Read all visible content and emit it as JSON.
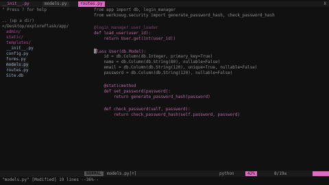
{
  "tabs": [
    "__init__.py",
    "models.py",
    "routes.py"
  ],
  "tab_close": "X",
  "sidebar": {
    "help": "\" Press ? for help",
    "up_dir": ".. (up a dir)",
    "path": "</Desktop/exploreFlask/app/",
    "items": [
      {
        "label": "admin/",
        "type": "dir"
      },
      {
        "label": "static/",
        "type": "dir"
      },
      {
        "label": "templates/",
        "type": "dir"
      },
      {
        "label": "__init__.py",
        "type": "file"
      },
      {
        "label": "config.py",
        "type": "file"
      },
      {
        "label": "forms.py",
        "type": "file"
      },
      {
        "label": "models.py",
        "type": "file"
      },
      {
        "label": "routes.py",
        "type": "file"
      },
      {
        "label": "Site.db",
        "type": "file"
      }
    ]
  },
  "code": {
    "l1": "from app import db, login_manager",
    "l2": "from werkzeug.security import generate_password_hash, check_password_hash",
    "l3": "@login_manager.user_loader",
    "l4": "def load_user(user_id):",
    "l5": "    return User.get(int(user_id))",
    "l6": "lass User(db.Model):",
    "l7": "    id = db.Column(db.Integer, primary_key=True)",
    "l8": "    name = db.Column(db.String(80), nullable=False)",
    "l9": "    email = db.Column(db.String(120), unique=True, nullable=False)",
    "l10": "    password = db.Column(db.String(120), nullable=False)",
    "l11": "    @staticmethod",
    "l12": "    def set_password(password):",
    "l13": "        return generate_password_hash(password)",
    "l14": "    def check_password(self, password):",
    "l15": "        return check_password_hash(self.password, password)"
  },
  "status": {
    "mode": "NORMAL",
    "file": "models.py[+]",
    "filetype": "python",
    "encoding": "42%",
    "position": "8/19≡",
    "command": "\"models.py\" [Modified] 19 lines --36%--"
  },
  "colors": {
    "accent": "#e26ac8",
    "directory": "#b9449e",
    "background": "#111111"
  }
}
